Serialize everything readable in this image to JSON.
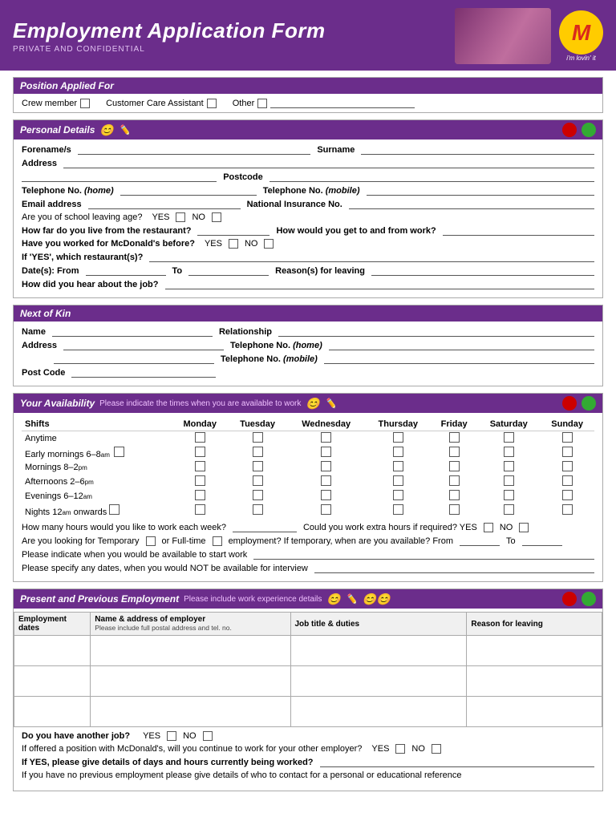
{
  "header": {
    "title": "Employment Application Form",
    "subtitle": "PRIVATE AND CONFIDENTIAL",
    "logo_text": "M",
    "logo_tagline": "i'm lovin' it"
  },
  "position_section": {
    "title": "Position Applied For",
    "options": [
      {
        "label": "Crew member"
      },
      {
        "label": "Customer Care Assistant"
      },
      {
        "label": "Other"
      }
    ]
  },
  "personal_section": {
    "title": "Personal Details",
    "fields": {
      "forenames_label": "Forename/s",
      "surname_label": "Surname",
      "address_label": "Address",
      "postcode_label": "Postcode",
      "telephone_home_label": "Telephone No.",
      "telephone_home_italic": "(home)",
      "telephone_mobile_label": "Telephone No.",
      "telephone_mobile_italic": "(mobile)",
      "email_label": "Email address",
      "ni_label": "National Insurance No.",
      "school_age_label": "Are you of school leaving age?",
      "yes_label": "YES",
      "no_label": "NO",
      "how_far_label": "How far do you live from the restaurant?",
      "how_get_label": "How would you get to and from work?",
      "worked_before_label": "Have you worked for McDonald's before?",
      "if_yes_label": "If 'YES', which restaurant(s)?",
      "dates_from_label": "Date(s): From",
      "dates_to_label": "To",
      "reason_leaving_label": "Reason(s) for leaving",
      "how_hear_label": "How did you hear about the job?"
    }
  },
  "kin_section": {
    "title": "Next of Kin",
    "fields": {
      "name_label": "Name",
      "relationship_label": "Relationship",
      "address_label": "Address",
      "telephone_home_label": "Telephone No.",
      "telephone_home_italic": "(home)",
      "telephone_mobile_label": "Telephone No.",
      "telephone_mobile_italic": "(mobile)",
      "postcode_label": "Post Code"
    }
  },
  "availability_section": {
    "title": "Your Availability",
    "note": "Please indicate the times when you are available to work",
    "shifts_label": "Shifts",
    "days": [
      "Monday",
      "Tuesday",
      "Wednesday",
      "Thursday",
      "Friday",
      "Saturday",
      "Sunday"
    ],
    "shift_types": [
      "Anytime",
      "Early mornings 6–8am",
      "Mornings 8–2pm",
      "Afternoons 2–6pm",
      "Evenings 6–12am",
      "Nights 12am onwards"
    ],
    "hours_label": "How many hours would you like to work each week?",
    "extra_hours_label": "Could you work extra hours if required? YES",
    "no_label": "NO",
    "temporary_label": "Are you looking for Temporary",
    "fulltime_label": "or Full-time",
    "employment_label": "employment? If temporary, when are you available? From",
    "to_label": "To",
    "start_work_label": "Please indicate when you would be available to start work",
    "not_available_label": "Please specify any dates, when you would NOT be available for interview"
  },
  "employment_section": {
    "title": "Present and Previous Employment",
    "note": "Please include work experience details",
    "columns": {
      "dates": "Employment dates",
      "name": "Name & address of employer",
      "name_note": "Please include full postal address and tel. no.",
      "job": "Job title & duties",
      "reason": "Reason for leaving"
    },
    "rows": 3,
    "another_job_label": "Do you have another job?",
    "yes_label": "YES",
    "no_label": "NO",
    "continue_label": "If offered a position with McDonald's, will you continue to work for your other employer?",
    "yes2_label": "YES",
    "no2_label": "NO",
    "if_yes_label": "If YES, please give details of days and hours currently being worked?",
    "no_prev_label": "If you have no previous employment please give details of who to contact for a personal or educational reference"
  }
}
